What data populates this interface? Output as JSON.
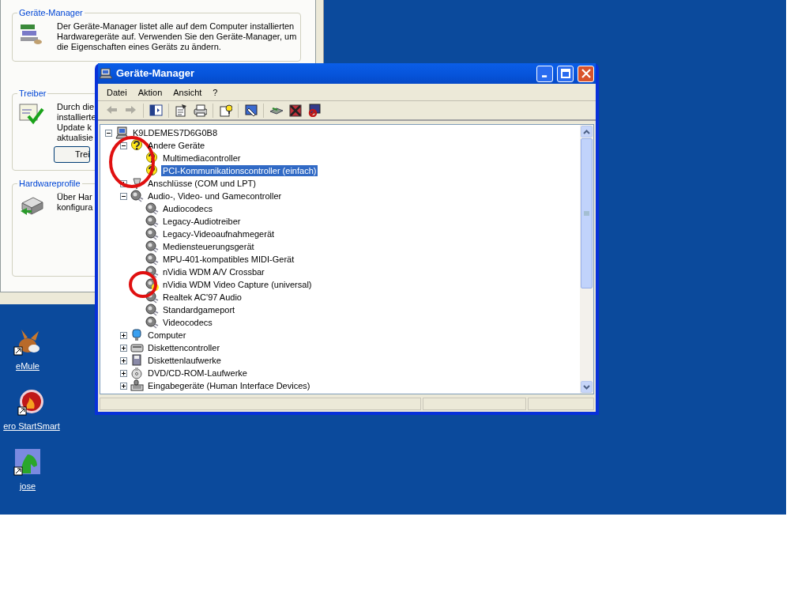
{
  "background_dialog": {
    "groups": [
      {
        "title": "Geräte-Manager",
        "lines": [
          "Der Geräte-Manager listet alle auf dem Computer installierten",
          "Hardwaregeräte auf. Verwenden Sie den Geräte-Manager, um",
          "die Eigenschaften eines Geräts zu ändern."
        ]
      },
      {
        "title": "Treiber",
        "lines": [
          "Durch die",
          "installierte",
          "Update k",
          "aktualisie"
        ],
        "button": "Trei"
      },
      {
        "title": "Hardwareprofile",
        "lines": [
          "Über Har",
          "konfigura"
        ]
      }
    ]
  },
  "desktop_icons": [
    {
      "label": "eMule"
    },
    {
      "label": "ero StartSmart"
    },
    {
      "label": "jose"
    }
  ],
  "window": {
    "title": "Geräte-Manager",
    "menu": [
      "Datei",
      "Aktion",
      "Ansicht",
      "?"
    ],
    "toolbar": [
      {
        "kind": "back",
        "disabled": true
      },
      {
        "kind": "forward",
        "disabled": true
      },
      {
        "kind": "sep"
      },
      {
        "kind": "tree",
        "disabled": false
      },
      {
        "kind": "sep"
      },
      {
        "kind": "properties",
        "disabled": false
      },
      {
        "kind": "print",
        "disabled": false
      },
      {
        "kind": "sep"
      },
      {
        "kind": "help",
        "disabled": false
      },
      {
        "kind": "sep"
      },
      {
        "kind": "scan",
        "disabled": false
      },
      {
        "kind": "sep"
      },
      {
        "kind": "update",
        "disabled": false
      },
      {
        "kind": "uninstall",
        "disabled": false
      },
      {
        "kind": "disable",
        "disabled": false
      }
    ],
    "tree": [
      {
        "label": "K9LDEMES7D6G0B8",
        "kind": "computer",
        "expanded": true,
        "selected": false,
        "children": [
          {
            "label": "Andere Geräte",
            "kind": "unknown",
            "expanded": true,
            "selected": false,
            "circled": true,
            "children": [
              {
                "label": "Multimediacontroller",
                "kind": "unknown",
                "selected": false
              },
              {
                "label": "PCI-Kommunikationscontroller (einfach)",
                "kind": "unknown",
                "selected": true
              }
            ]
          },
          {
            "label": "Anschlüsse (COM und LPT)",
            "kind": "port",
            "expanded": false,
            "selected": false
          },
          {
            "label": "Audio-, Video- und Gamecontroller",
            "kind": "sound",
            "expanded": true,
            "selected": false,
            "children": [
              {
                "label": "Audiocodecs",
                "kind": "sound",
                "selected": false
              },
              {
                "label": "Legacy-Audiotreiber",
                "kind": "sound",
                "selected": false
              },
              {
                "label": "Legacy-Videoaufnahmegerät",
                "kind": "sound",
                "selected": false
              },
              {
                "label": "Mediensteuerungsgerät",
                "kind": "sound",
                "selected": false
              },
              {
                "label": "MPU-401-kompatibles MIDI-Gerät",
                "kind": "sound",
                "selected": false
              },
              {
                "label": "nVidia WDM A/V Crossbar",
                "kind": "sound",
                "selected": false
              },
              {
                "label": "nVidia WDM Video Capture (universal)",
                "kind": "sound",
                "selected": false,
                "warning": true,
                "circled": true
              },
              {
                "label": "Realtek AC'97 Audio",
                "kind": "sound",
                "selected": false
              },
              {
                "label": "Standardgameport",
                "kind": "sound",
                "selected": false
              },
              {
                "label": "Videocodecs",
                "kind": "sound",
                "selected": false
              }
            ]
          },
          {
            "label": "Computer",
            "kind": "monitor",
            "expanded": false,
            "selected": false
          },
          {
            "label": "Diskettencontroller",
            "kind": "controller",
            "expanded": false,
            "selected": false
          },
          {
            "label": "Diskettenlaufwerke",
            "kind": "floppy",
            "expanded": false,
            "selected": false
          },
          {
            "label": "DVD/CD-ROM-Laufwerke",
            "kind": "cdrom",
            "expanded": false,
            "selected": false
          },
          {
            "label": "Eingabegeräte (Human Interface Devices)",
            "kind": "hid",
            "expanded": false,
            "selected": false
          }
        ]
      }
    ]
  }
}
